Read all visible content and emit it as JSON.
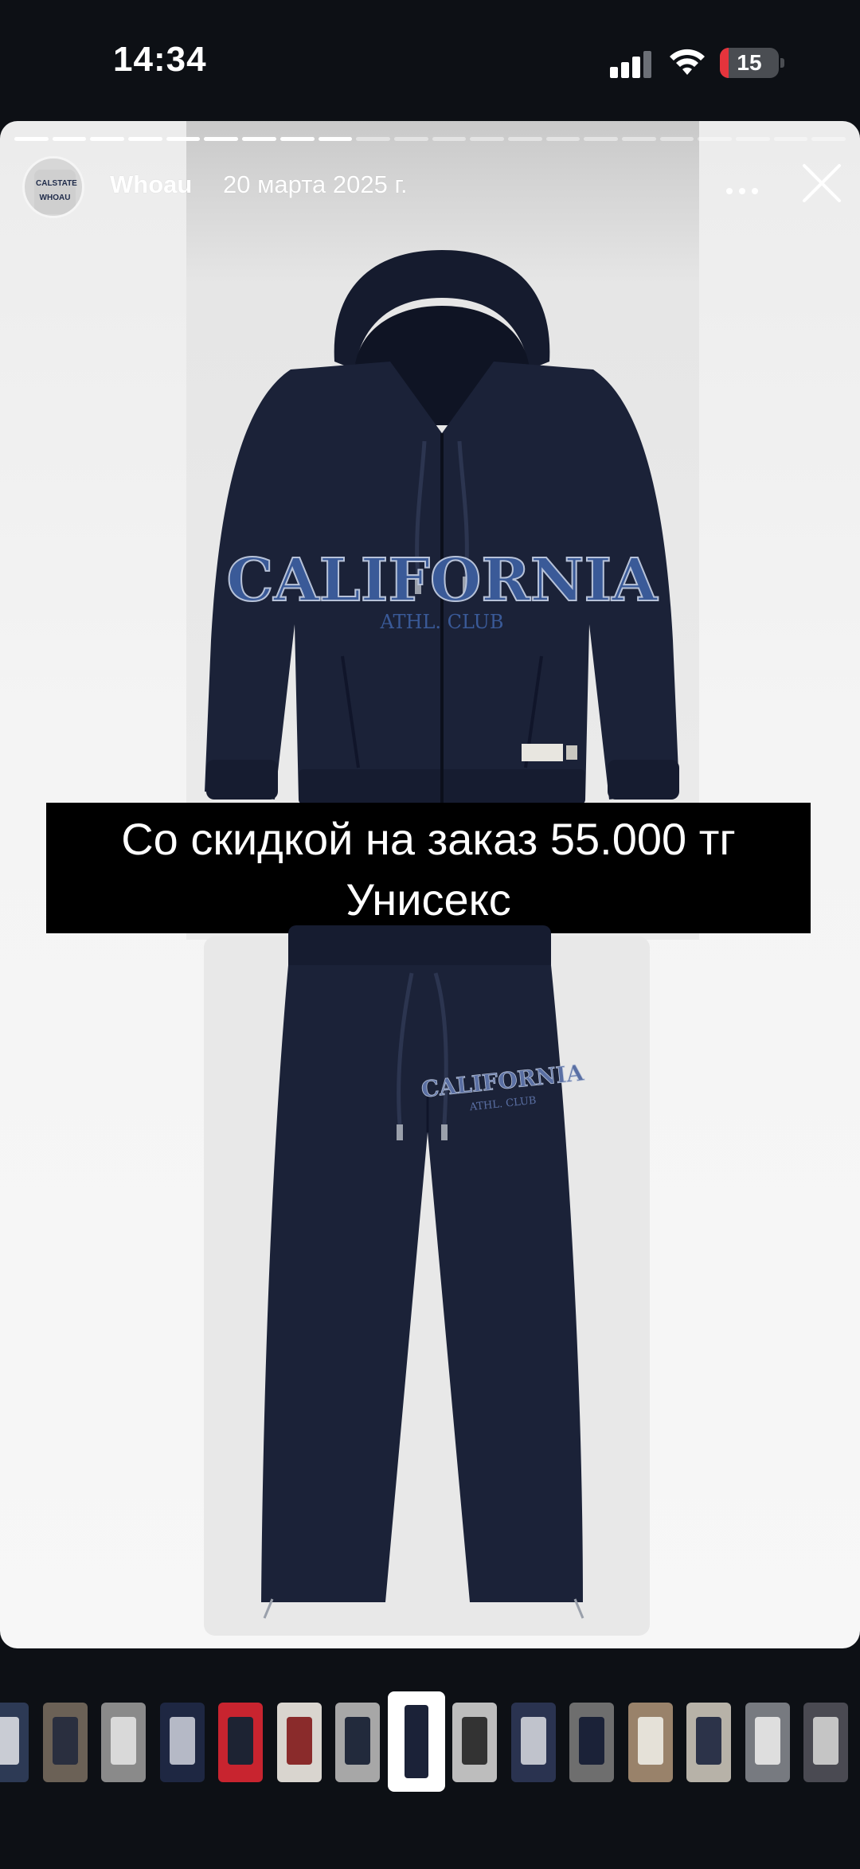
{
  "status_bar": {
    "time": "14:34",
    "battery": "15",
    "battery_level": 0.15,
    "battery_color": "#e5343c"
  },
  "story": {
    "username": "Whoau",
    "date": "20 марта 2025 г.",
    "progress": {
      "total": 22,
      "current": 9
    },
    "avatar_text": [
      "CALSTATE",
      "WHOAU"
    ],
    "hoodie_print": [
      "CALIFORNIA",
      "ATHL. CLUB"
    ],
    "pants_print": [
      "CALIFORNIA",
      "ATHL. CLUB"
    ],
    "caption_line1": "Со скидкой на заказ 55.000 тг",
    "caption_line2": "Унисекс"
  },
  "icons": [
    "more-icon",
    "close-icon",
    "wifi-icon",
    "signal-icon",
    "battery-icon"
  ],
  "colors": {
    "background": "#0d1015",
    "navy": "#1b2238",
    "accent_blue": "#3a5a98"
  },
  "thumbnails": [
    {
      "bg": "#2d3a55",
      "accent": "#c9ccd4"
    },
    {
      "bg": "#6b6156",
      "accent": "#2a2f3f"
    },
    {
      "bg": "#8a8a8a",
      "accent": "#d9d9d9"
    },
    {
      "bg": "#1e2742",
      "accent": "#b5b9c6"
    },
    {
      "bg": "#c8242f",
      "accent": "#1d2333"
    },
    {
      "bg": "#d9d5cf",
      "accent": "#8a2b2b"
    },
    {
      "bg": "#a7a7a7",
      "accent": "#222a3c"
    },
    {
      "bg": "#ffffff",
      "accent": "#1b2238",
      "active": true
    },
    {
      "bg": "#bdbdbd",
      "accent": "#333"
    },
    {
      "bg": "#2a3350",
      "accent": "#c0c3cc"
    },
    {
      "bg": "#6e6e6e",
      "accent": "#1b2238"
    },
    {
      "bg": "#99826a",
      "accent": "#e5e1d8"
    },
    {
      "bg": "#b7b2a8",
      "accent": "#2c3349"
    },
    {
      "bg": "#777a80",
      "accent": "#dedede"
    },
    {
      "bg": "#4a4a52",
      "accent": "#c5c5c5"
    }
  ]
}
